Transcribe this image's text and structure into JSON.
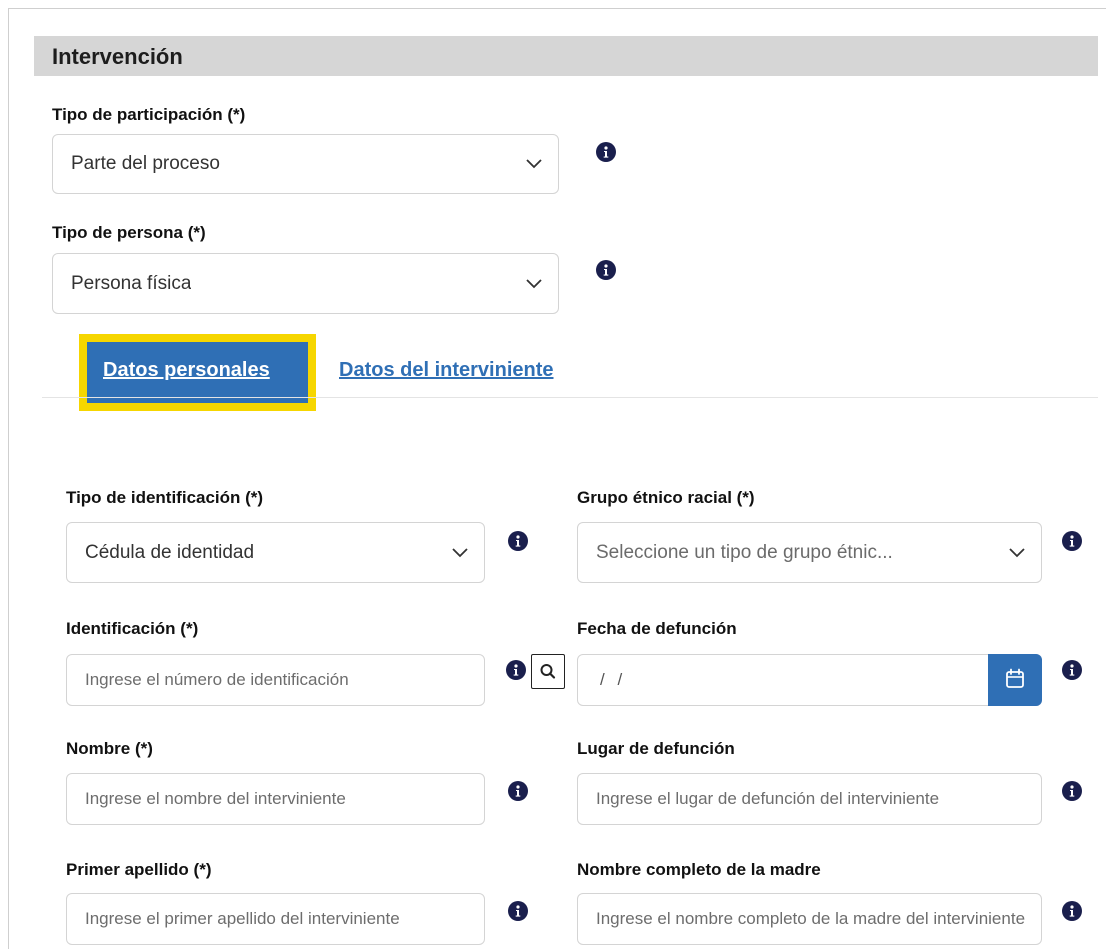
{
  "section": {
    "title": "Intervención"
  },
  "participacion": {
    "label": "Tipo de participación (*)",
    "value": "Parte del proceso"
  },
  "persona": {
    "label": "Tipo de persona (*)",
    "value": "Persona física"
  },
  "tabs": [
    {
      "label": "Datos personales",
      "active": true
    },
    {
      "label": "Datos del interviniente",
      "active": false
    }
  ],
  "form": {
    "tipo_identificacion": {
      "label": "Tipo de identificación (*)",
      "value": "Cédula de identidad"
    },
    "grupo_etnico": {
      "label": "Grupo étnico racial (*)",
      "placeholder": "Seleccione un tipo de grupo étnic..."
    },
    "identificacion": {
      "label": "Identificación (*)",
      "placeholder": "Ingrese el número de identificación"
    },
    "fecha_defuncion": {
      "label": "Fecha de defunción",
      "value": "/ /"
    },
    "nombre": {
      "label": "Nombre (*)",
      "placeholder": "Ingrese el nombre del interviniente"
    },
    "lugar_defuncion": {
      "label": "Lugar de defunción",
      "placeholder": "Ingrese el lugar de defunción del interviniente"
    },
    "primer_apellido": {
      "label": "Primer apellido (*)",
      "placeholder": "Ingrese el primer apellido del interviniente"
    },
    "nombre_madre": {
      "label": "Nombre completo de la madre",
      "placeholder": "Ingrese el nombre completo de la madre del interviniente"
    }
  },
  "colors": {
    "accent": "#2f6fb5",
    "highlight": "#f6d600",
    "info_icon": "#1a1f4d",
    "header_bg": "#d6d6d6"
  },
  "icons": [
    "info-icon",
    "chevron-down-icon",
    "search-icon",
    "calendar-icon"
  ]
}
